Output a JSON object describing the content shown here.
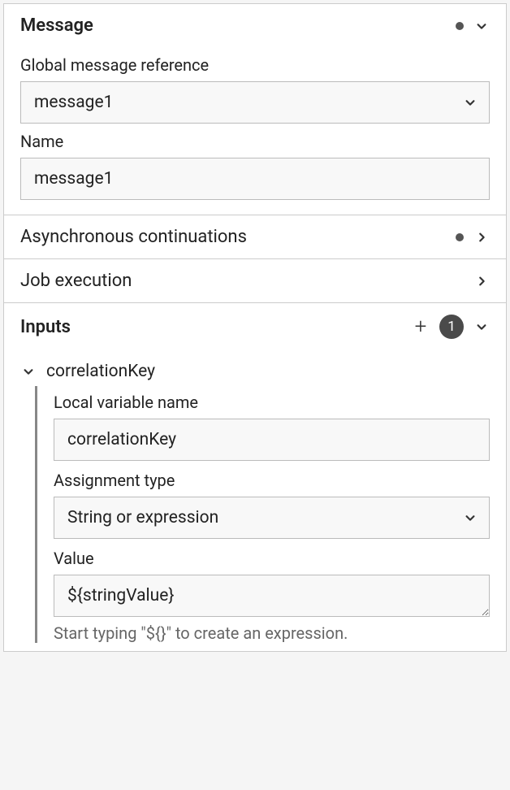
{
  "message": {
    "title": "Message",
    "globalRefLabel": "Global message reference",
    "globalRefValue": "message1",
    "nameLabel": "Name",
    "nameValue": "message1"
  },
  "asyncContinuations": {
    "title": "Asynchronous continuations"
  },
  "jobExecution": {
    "title": "Job execution"
  },
  "inputs": {
    "title": "Inputs",
    "count": "1",
    "items": [
      {
        "name": "correlationKey",
        "localVarLabel": "Local variable name",
        "localVarValue": "correlationKey",
        "assignmentTypeLabel": "Assignment type",
        "assignmentTypeValue": "String or expression",
        "valueLabel": "Value",
        "valueValue": "${stringValue}",
        "valueHint": "Start typing \"${}\" to create an expression."
      }
    ]
  }
}
